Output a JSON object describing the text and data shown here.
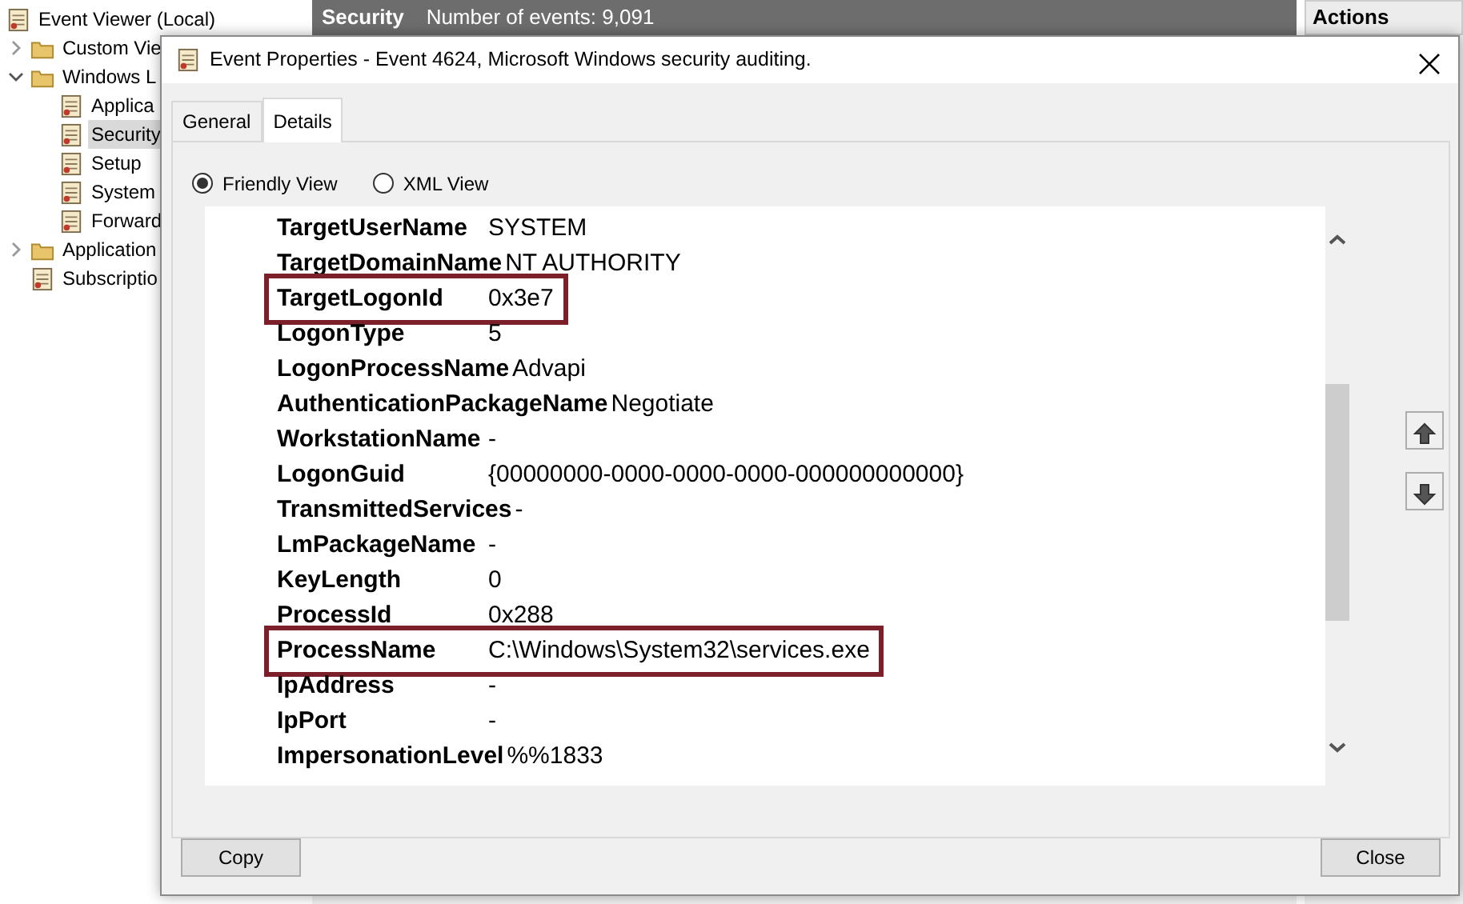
{
  "tree": {
    "label": "Event Viewer (Local)",
    "children": [
      {
        "label": "Custom Vie",
        "expanded": false,
        "selected": false
      },
      {
        "label": "Windows L",
        "expanded": true,
        "selected": false,
        "children": [
          {
            "label": "Applica",
            "selected": false
          },
          {
            "label": "Security",
            "selected": true
          },
          {
            "label": "Setup",
            "selected": false
          },
          {
            "label": "System",
            "selected": false
          },
          {
            "label": "Forward",
            "selected": false
          }
        ]
      },
      {
        "label": "Application",
        "expanded": false,
        "selected": false
      },
      {
        "label": "Subscriptio",
        "selected": false
      }
    ]
  },
  "log_header": {
    "title": "Security",
    "count": "Number of events: 9,091"
  },
  "actions_header": "Actions",
  "dialog": {
    "title": "Event Properties - Event 4624, Microsoft Windows security auditing.",
    "tabs": [
      {
        "label": "General",
        "selected": false
      },
      {
        "label": "Details",
        "selected": true
      }
    ],
    "views": [
      {
        "label": "Friendly View",
        "selected": true
      },
      {
        "label": "XML View",
        "selected": false
      }
    ],
    "fields": [
      {
        "name": "TargetUserName",
        "value": "SYSTEM",
        "highlighted": false
      },
      {
        "name": "TargetDomainName",
        "value": "NT AUTHORITY",
        "highlighted": false
      },
      {
        "name": "TargetLogonId",
        "value": "0x3e7",
        "highlighted": true
      },
      {
        "name": "LogonType",
        "value": "5",
        "highlighted": false
      },
      {
        "name": "LogonProcessName",
        "value": "Advapi",
        "highlighted": false
      },
      {
        "name": "AuthenticationPackageName",
        "value": "Negotiate",
        "highlighted": false
      },
      {
        "name": "WorkstationName",
        "value": "-",
        "highlighted": false
      },
      {
        "name": "LogonGuid",
        "value": "{00000000-0000-0000-0000-000000000000}",
        "highlighted": false
      },
      {
        "name": "TransmittedServices",
        "value": "-",
        "highlighted": false
      },
      {
        "name": "LmPackageName",
        "value": "-",
        "highlighted": false
      },
      {
        "name": "KeyLength",
        "value": "0",
        "highlighted": false
      },
      {
        "name": "ProcessId",
        "value": "0x288",
        "highlighted": false
      },
      {
        "name": "ProcessName",
        "value": "C:\\Windows\\System32\\services.exe",
        "highlighted": true
      },
      {
        "name": "IpAddress",
        "value": "-",
        "highlighted": false
      },
      {
        "name": "IpPort",
        "value": "-",
        "highlighted": false
      },
      {
        "name": "ImpersonationLevel",
        "value": "%%1833",
        "highlighted": false
      }
    ],
    "buttons": [
      {
        "label": "Copy"
      },
      {
        "label": "Close"
      }
    ]
  }
}
